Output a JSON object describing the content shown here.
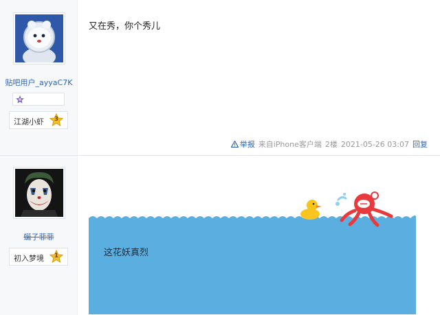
{
  "posts": [
    {
      "user": {
        "name": "贴吧用户_ayyaC7K",
        "avatar": "bear-astronaut-avatar",
        "badge_icon": "member-badge-icon",
        "level_name": "江湖小虾",
        "level_num": "3"
      },
      "text": "又在秀，你个秀儿",
      "tail": {
        "report": "举报",
        "source": "来自iPhone客户端",
        "floor": "2楼",
        "time": "2021-05-26 03:07",
        "reply": "回复"
      }
    },
    {
      "user": {
        "name": "蜒子菲菲",
        "avatar": "joker-avatar",
        "level_name": "初入梦境",
        "level_num": "1"
      },
      "image": {
        "caption": "这花妖真烈",
        "water_color": "#5aafe0",
        "duck_color": "#f7c51e"
      }
    }
  ],
  "colors": {
    "link": "#2d64b3",
    "sidebar_bg": "#f7f8fa",
    "muted": "#999999"
  }
}
